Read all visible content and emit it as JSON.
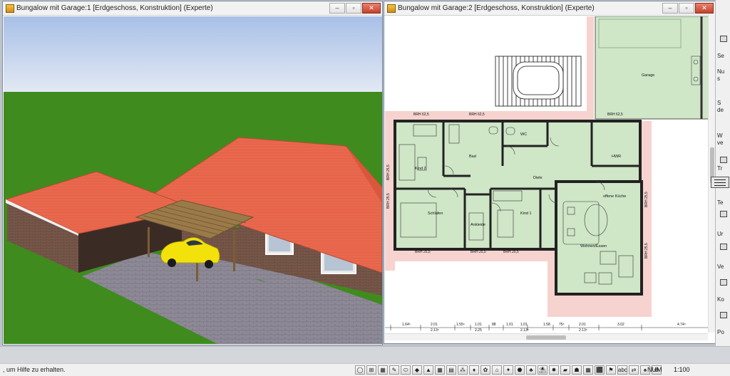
{
  "window_left": {
    "title": "Bungalow mit Garage:1 [Erdgeschoss, Konstruktion] (Experte)"
  },
  "window_right": {
    "title": "Bungalow mit Garage:2 [Erdgeschoss, Konstruktion] (Experte)"
  },
  "window_buttons": {
    "minimize": "–",
    "maximize": "▫",
    "close": "✕"
  },
  "plan": {
    "rooms": {
      "garage": "Garage",
      "kind2": "Kind 2",
      "bad": "Bad",
      "wc": "WC",
      "diele": "Diele",
      "hwr": "HWR",
      "schlafen": "Schlafen",
      "ankleide": "Ankleide",
      "kind1": "Kind 1",
      "kueche": "offene Küche",
      "wohnen": "Wohnen/Essen"
    },
    "brh_labels": [
      "BRH 62,5",
      "BRH 62,5",
      "BRH 62,5",
      "BRH 25,5",
      "BRH 25,5",
      "BRH 25,5",
      "BRH 25,5",
      "BRH 25,5",
      "BRH 25,5",
      "BRH 25,5"
    ],
    "dimensions": [
      "1.64⁵",
      "2.01",
      "2.13⁵",
      "1.55⁵",
      "1.01",
      "2.25",
      "1.01",
      "88",
      "1.01",
      "2.13⁵",
      "1.58",
      "75⁵",
      "2.01",
      "2.13⁵",
      "3.02",
      "4.74⁵"
    ]
  },
  "tool_panel": {
    "items": [
      "Se",
      "Nu",
      "s",
      "S",
      "de",
      "W",
      "ve",
      "Tr",
      "Te",
      "Ur",
      "Ve",
      "Ko",
      "Po"
    ]
  },
  "statusbar": {
    "help_text": ", um Hilfe zu erhalten.",
    "num": "NUM",
    "scale": "1:100",
    "tools": [
      "◯",
      "⊞",
      "▦",
      "✎",
      "⬭",
      "◆",
      "▲",
      "▦",
      "▤",
      "⁂",
      "♦",
      "✿",
      "⌂",
      "✦",
      "⬣",
      "♣",
      "⛱",
      "✸",
      "▰",
      "☗",
      "▦",
      "⬛",
      "⚑",
      "abc",
      "⇄",
      "♠",
      "⚙"
    ]
  },
  "colors": {
    "sky_top": "#a9c1e6",
    "sky_bottom": "#e1e7f3",
    "grass": "#3f8a1f",
    "roof": "#e8674c",
    "wall_brick": "#7a5a4a",
    "paving": "#8a8694",
    "room_fill": "#cfe6c7",
    "terrace_hatch": "#f3c9c4",
    "car": "#f4e10a"
  }
}
